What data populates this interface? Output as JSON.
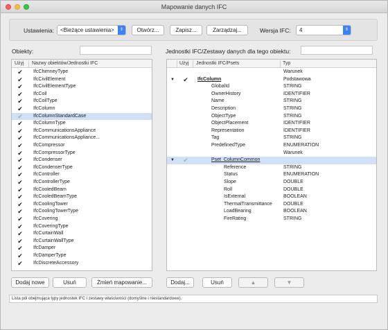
{
  "window": {
    "title": "Mapowanie danych IFC"
  },
  "toolbar": {
    "settings_label": "Ustawienia:",
    "settings_value": "<Bieżące ustawienia>",
    "open_label": "Otwórz...",
    "save_label": "Zapisz...",
    "manage_label": "Zarządzaj...",
    "version_label": "Wersja IFC:",
    "version_value": "4"
  },
  "left": {
    "heading": "Obiekty:",
    "col_use": "Użyj",
    "col_name": "Nazwy obiektów/Jednostki IFC",
    "selected_index": 6,
    "rows": [
      {
        "name": "IfcChimneyType",
        "state": "on"
      },
      {
        "name": "IfcCivilElement",
        "state": "on"
      },
      {
        "name": "IfcCivilElementType",
        "state": "on"
      },
      {
        "name": "IfcCoil",
        "state": "on"
      },
      {
        "name": "IfcCoilType",
        "state": "on"
      },
      {
        "name": "IfcColumn",
        "state": "on"
      },
      {
        "name": "IfcColumnStandardCase",
        "state": "partial"
      },
      {
        "name": "IfcColumnType",
        "state": "on"
      },
      {
        "name": "IfcCommunicationsAppliance",
        "state": "on"
      },
      {
        "name": "IfcCommunicationsAppliance...",
        "state": "on"
      },
      {
        "name": "IfcCompressor",
        "state": "on"
      },
      {
        "name": "IfcCompressorType",
        "state": "on"
      },
      {
        "name": "IfcCondenser",
        "state": "on"
      },
      {
        "name": "IfcCondenserType",
        "state": "on"
      },
      {
        "name": "IfcController",
        "state": "on"
      },
      {
        "name": "IfcControllerType",
        "state": "on"
      },
      {
        "name": "IfcCooledBeam",
        "state": "on"
      },
      {
        "name": "IfcCooledBeamType",
        "state": "on"
      },
      {
        "name": "IfcCoolingTower",
        "state": "on"
      },
      {
        "name": "IfcCoolingTowerType",
        "state": "on"
      },
      {
        "name": "IfcCovering",
        "state": "on"
      },
      {
        "name": "IfcCoveringType",
        "state": "on"
      },
      {
        "name": "IfcCurtainWall",
        "state": "on"
      },
      {
        "name": "IfcCurtainWallType",
        "state": "on"
      },
      {
        "name": "IfcDamper",
        "state": "on"
      },
      {
        "name": "IfcDamperType",
        "state": "on"
      },
      {
        "name": "IfcDiscreteAccessory",
        "state": "on"
      }
    ],
    "buttons": {
      "add": "Dodaj nowe",
      "remove": "Usuń",
      "change": "Zmień mapowanie..."
    }
  },
  "right": {
    "heading": "Jednostki IFC/Zestawy danych dla tego obiektu:",
    "col_use": "Użyj",
    "col_name": "Jednostki IFC/Psets",
    "col_type": "Typ",
    "rows": [
      {
        "tri": "",
        "check": "",
        "name": "",
        "type": "Warunek",
        "indent": 0,
        "style": "",
        "sel": false
      },
      {
        "tri": "▼",
        "check": "on",
        "name": "IfcColumn",
        "type": "Podstawowa",
        "indent": 0,
        "style": "bold-u",
        "sel": false
      },
      {
        "tri": "",
        "check": "",
        "name": "GlobalId",
        "type": "STRING",
        "indent": 1,
        "style": "",
        "sel": false
      },
      {
        "tri": "",
        "check": "",
        "name": "OwnerHistory",
        "type": "IDENTIFIER",
        "indent": 1,
        "style": "",
        "sel": false
      },
      {
        "tri": "",
        "check": "",
        "name": "Name",
        "type": "STRING",
        "indent": 1,
        "style": "",
        "sel": false
      },
      {
        "tri": "",
        "check": "",
        "name": "Description",
        "type": "STRING",
        "indent": 1,
        "style": "",
        "sel": false
      },
      {
        "tri": "",
        "check": "",
        "name": "ObjectType",
        "type": "STRING",
        "indent": 1,
        "style": "",
        "sel": false
      },
      {
        "tri": "",
        "check": "",
        "name": "ObjectPlacement",
        "type": "IDENTIFIER",
        "indent": 1,
        "style": "",
        "sel": false
      },
      {
        "tri": "",
        "check": "",
        "name": "Representation",
        "type": "IDENTIFIER",
        "indent": 1,
        "style": "",
        "sel": false
      },
      {
        "tri": "",
        "check": "",
        "name": "Tag",
        "type": "STRING",
        "indent": 1,
        "style": "",
        "sel": false
      },
      {
        "tri": "",
        "check": "",
        "name": "PredefinedType",
        "type": "ENUMERATION",
        "indent": 1,
        "style": "",
        "sel": false
      },
      {
        "tri": "",
        "check": "",
        "name": "",
        "type": "Warunek",
        "indent": 0,
        "style": "",
        "sel": false
      },
      {
        "tri": "▼",
        "check": "partial",
        "name": "Pset_ColumnCommon",
        "type": "",
        "indent": 1,
        "style": "u",
        "sel": true
      },
      {
        "tri": "",
        "check": "",
        "name": "Reference",
        "type": "STRING",
        "indent": 2,
        "style": "",
        "sel": false
      },
      {
        "tri": "",
        "check": "",
        "name": "Status",
        "type": "ENUMERATION",
        "indent": 2,
        "style": "",
        "sel": false
      },
      {
        "tri": "",
        "check": "",
        "name": "Slope",
        "type": "DOUBLE",
        "indent": 2,
        "style": "",
        "sel": false
      },
      {
        "tri": "",
        "check": "",
        "name": "Roll",
        "type": "DOUBLE",
        "indent": 2,
        "style": "",
        "sel": false
      },
      {
        "tri": "",
        "check": "",
        "name": "IsExternal",
        "type": "BOOLEAN",
        "indent": 2,
        "style": "",
        "sel": false
      },
      {
        "tri": "",
        "check": "",
        "name": "ThermalTransmittance",
        "type": "DOUBLE",
        "indent": 2,
        "style": "",
        "sel": false
      },
      {
        "tri": "",
        "check": "",
        "name": "LoadBearing",
        "type": "BOOLEAN",
        "indent": 2,
        "style": "",
        "sel": false
      },
      {
        "tri": "",
        "check": "",
        "name": "FireRating",
        "type": "STRING",
        "indent": 2,
        "style": "",
        "sel": false
      }
    ],
    "buttons": {
      "add": "Dodaj...",
      "remove": "Usuń",
      "up": "▲",
      "down": "▼"
    }
  },
  "status": "Lista pól obejmująca typy jednostek IFC i zestawy właściwości (domyślne i niestandardowe).",
  "colors": {
    "accent": "#3b82f6",
    "selection": "#cfe0f7"
  }
}
